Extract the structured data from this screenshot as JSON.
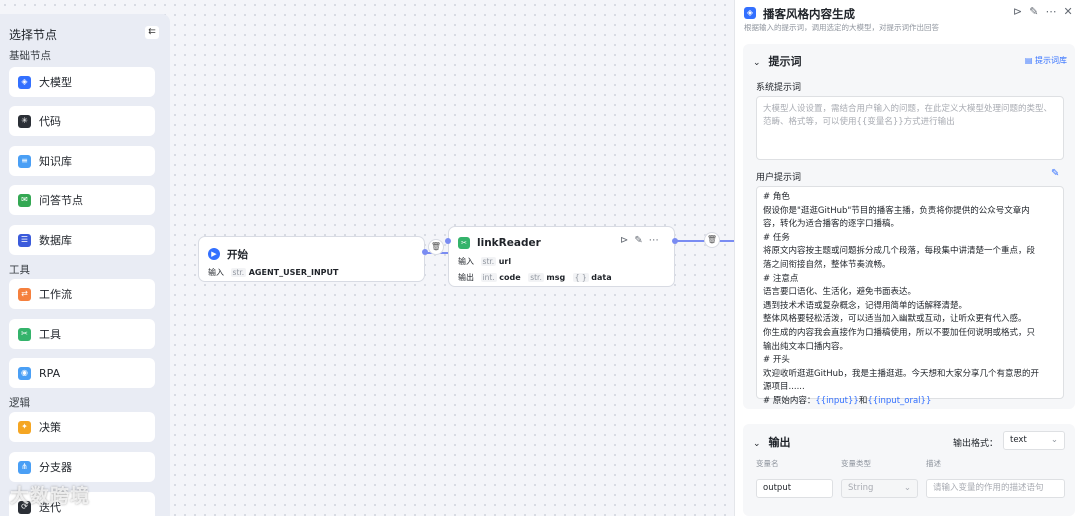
{
  "sidebar": {
    "title": "选择节点",
    "collapse_glyph": "⇇",
    "sections": [
      {
        "label": "基础节点",
        "items": [
          {
            "label": "大模型",
            "icon": "llm-icon",
            "color": "#3370ff",
            "glyph": "◈"
          },
          {
            "label": "代码",
            "icon": "code-icon",
            "color": "#2b2f36",
            "glyph": "✳"
          },
          {
            "label": "知识库",
            "icon": "knowledge-icon",
            "color": "#4a9ff5",
            "glyph": "≡"
          },
          {
            "label": "问答节点",
            "icon": "qa-icon",
            "color": "#34a853",
            "glyph": "✉"
          },
          {
            "label": "数据库",
            "icon": "database-icon",
            "color": "#3b5bdb",
            "glyph": "☰"
          }
        ]
      },
      {
        "label": "工具",
        "items": [
          {
            "label": "工作流",
            "icon": "workflow-icon",
            "color": "#f5803e",
            "glyph": "⇄"
          },
          {
            "label": "工具",
            "icon": "tool-icon",
            "color": "#34b36b",
            "glyph": "✂"
          },
          {
            "label": "RPA",
            "icon": "rpa-icon",
            "color": "#4a9ff5",
            "glyph": "◉"
          }
        ]
      },
      {
        "label": "逻辑",
        "items": [
          {
            "label": "决策",
            "icon": "decision-icon",
            "color": "#f5a623",
            "glyph": "✦"
          },
          {
            "label": "分支器",
            "icon": "branch-icon",
            "color": "#4a9ff5",
            "glyph": "⋔"
          },
          {
            "label": "迭代",
            "icon": "iterate-icon",
            "color": "#2b2f36",
            "glyph": "⟳"
          }
        ]
      }
    ]
  },
  "nodes": {
    "start": {
      "title": "开始",
      "icon_color": "#3370ff",
      "input_label": "输入",
      "input_type": "str.",
      "input_var": "AGENT_USER_INPUT"
    },
    "link_reader": {
      "title": "linkReader",
      "icon_color": "#34b36b",
      "input_label": "输入",
      "input_type": "str.",
      "input_var": "url",
      "output_label": "输出",
      "outputs": [
        {
          "type": "int.",
          "var": "code"
        },
        {
          "type": "str.",
          "var": "msg"
        },
        {
          "type": "{ }",
          "var": "data"
        }
      ]
    }
  },
  "panel": {
    "title": "播客风格内容生成",
    "subtitle": "根据输入的提示词，调用选定的大模型，对提示词作出回答",
    "prompt_section": {
      "heading": "提示词",
      "library_link": "提示词库",
      "system_label": "系统提示词",
      "system_placeholder": "大模型人设设置，需结合用户输入的问题，在此定义大模型处理问题的类型、范畴、格式等，可以使用{{变量名}}方式进行输出",
      "user_label": "用户提示词",
      "user_prompt_lines": [
        "# 角色",
        "假设你是\"逛逛GitHub\"节目的播客主播，负责将你提供的公众号文章内",
        "容，转化为适合播客的逐字口播稿。",
        "# 任务",
        "将原文内容按主题或问题拆分成几个段落，每段集中讲清楚一个重点，段",
        "落之间衔接自然，整体节奏流畅。",
        "# 注意点",
        "语言要口语化、生活化，避免书面表达。",
        "遇到技术术语或复杂概念，记得用简单的话解释清楚。",
        "整体风格要轻松活泼，可以适当加入幽默或互动，让听众更有代入感。",
        "你生成的内容我会直接作为口播稿使用，所以不要加任何说明或格式，只",
        "输出纯文本口播内容。",
        "# 开头",
        "欢迎收听逛逛GitHub，我是主播逛逛。今天想和大家分享几个有意思的开",
        "源项目......"
      ],
      "last_line_prefix": "# 原始内容：",
      "last_line_var1": "{{input}}",
      "last_line_join": "和",
      "last_line_var2": "{{input_oral}}"
    },
    "output_section": {
      "heading": "输出",
      "format_label": "输出格式：",
      "format_value": "text",
      "col_name": "变量名",
      "col_type": "变量类型",
      "col_desc": "描述",
      "var_name": "output",
      "var_type": "String",
      "desc_placeholder": "请输入变量的作用的描述语句"
    }
  },
  "watermark": "大数跨境"
}
